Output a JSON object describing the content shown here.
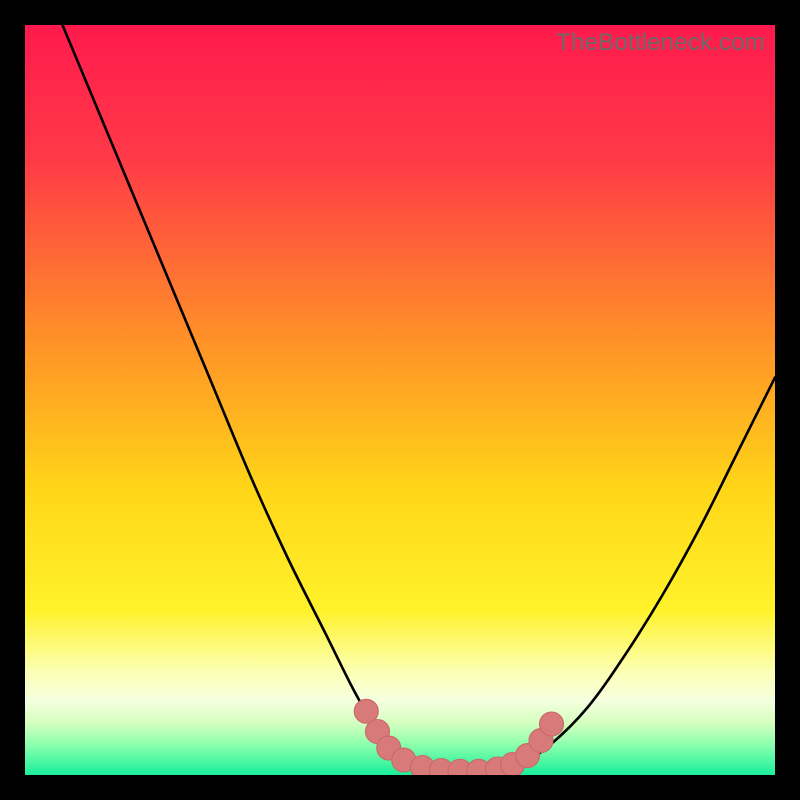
{
  "watermark": "TheBottleneck.com",
  "colors": {
    "frame": "#000000",
    "gradient_stops": [
      {
        "pos": 0.0,
        "color": "#ff1a4d"
      },
      {
        "pos": 0.18,
        "color": "#ff3a47"
      },
      {
        "pos": 0.4,
        "color": "#ff8a2a"
      },
      {
        "pos": 0.62,
        "color": "#ffd618"
      },
      {
        "pos": 0.78,
        "color": "#fff22a"
      },
      {
        "pos": 0.86,
        "color": "#fcffb0"
      },
      {
        "pos": 0.9,
        "color": "#f6ffe0"
      },
      {
        "pos": 0.93,
        "color": "#d6ffc0"
      },
      {
        "pos": 0.96,
        "color": "#8affac"
      },
      {
        "pos": 1.0,
        "color": "#18ef9a"
      }
    ],
    "curve": "#000000",
    "marker_fill": "#d87a7a",
    "marker_stroke": "#c96969"
  },
  "chart_data": {
    "type": "line",
    "title": "",
    "xlabel": "",
    "ylabel": "",
    "xlim": [
      0,
      100
    ],
    "ylim": [
      0,
      100
    ],
    "series": [
      {
        "name": "bottleneck-curve",
        "x": [
          5,
          10,
          15,
          20,
          25,
          30,
          35,
          40,
          44,
          47,
          50,
          53,
          56,
          60,
          62,
          66,
          70,
          75,
          80,
          85,
          90,
          95,
          100
        ],
        "y": [
          100,
          88,
          76,
          64,
          52,
          40,
          29,
          19,
          11,
          6,
          3,
          1.2,
          0.6,
          0.5,
          0.6,
          1.4,
          4,
          9,
          16,
          24,
          33,
          43,
          53
        ]
      }
    ],
    "markers": [
      {
        "x": 45.5,
        "y": 8.5,
        "r": 1.6
      },
      {
        "x": 47.0,
        "y": 5.8,
        "r": 1.6
      },
      {
        "x": 48.5,
        "y": 3.6,
        "r": 1.6
      },
      {
        "x": 50.5,
        "y": 2.0,
        "r": 1.6
      },
      {
        "x": 53.0,
        "y": 1.0,
        "r": 1.6
      },
      {
        "x": 55.5,
        "y": 0.6,
        "r": 1.6
      },
      {
        "x": 58.0,
        "y": 0.5,
        "r": 1.6
      },
      {
        "x": 60.5,
        "y": 0.5,
        "r": 1.6
      },
      {
        "x": 63.0,
        "y": 0.8,
        "r": 1.6
      },
      {
        "x": 65.0,
        "y": 1.4,
        "r": 1.6
      },
      {
        "x": 67.0,
        "y": 2.6,
        "r": 1.6
      },
      {
        "x": 68.8,
        "y": 4.6,
        "r": 1.6
      },
      {
        "x": 70.2,
        "y": 6.8,
        "r": 1.6
      }
    ]
  }
}
